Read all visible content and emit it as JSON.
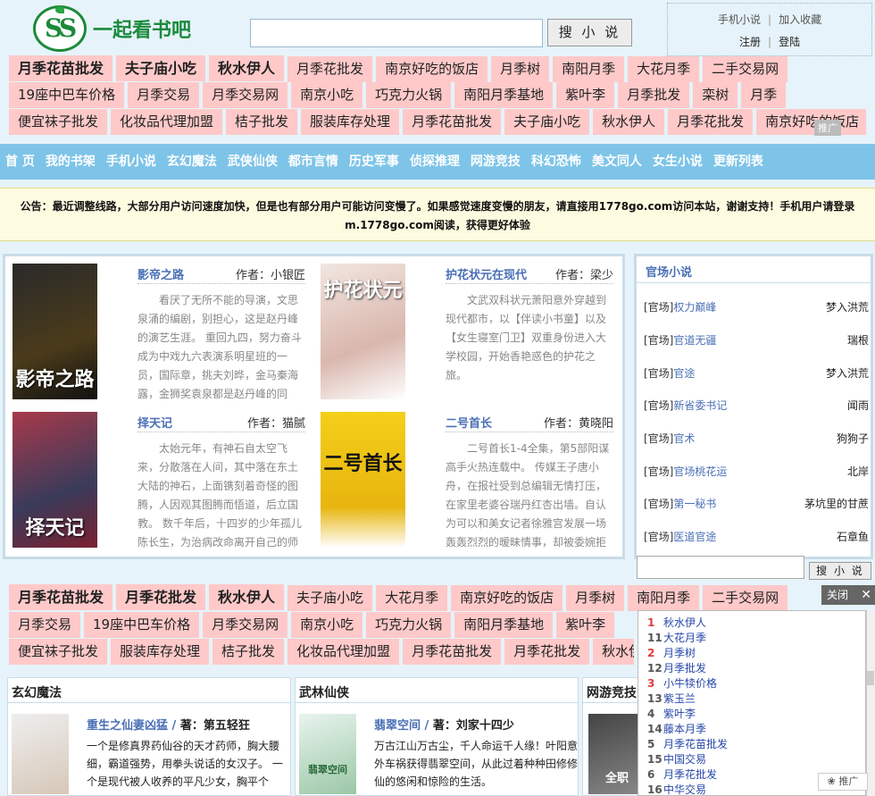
{
  "header": {
    "logo_text": "一起看书吧",
    "search_placeholder": "",
    "search_button": "搜 小 说",
    "user_links": [
      "手机小说",
      "加入收藏"
    ],
    "login_links": [
      "注册",
      "登陆"
    ]
  },
  "keywords_top": [
    [
      "月季花苗批发",
      "夫子庙小吃",
      "秋水伊人",
      "月季花批发",
      "南京好吃的饭店",
      "月季树",
      "南阳月季",
      "大花月季",
      "二手交易网"
    ],
    [
      "19座中巴车价格",
      "月季交易",
      "月季交易网",
      "南京小吃",
      "巧克力火锅",
      "南阳月季基地",
      "紫叶李",
      "月季批发",
      "栾树",
      "月季"
    ],
    [
      "便宜袜子批发",
      "化妆品代理加盟",
      "桔子批发",
      "服装库存处理",
      "月季花苗批发",
      "夫子庙小吃",
      "秋水伊人",
      "月季花批发",
      "南京好吃的饭店"
    ]
  ],
  "ad_tag": "推广",
  "nav": [
    "首 页",
    "我的书架",
    "手机小说",
    "玄幻魔法",
    "武侠仙侠",
    "都市言情",
    "历史军事",
    "侦探推理",
    "网游竞技",
    "科幻恐怖",
    "美文同人",
    "女生小说",
    "更新列表"
  ],
  "notice": "公告：最近调整线路，大部分用户访问速度加快，但是也有部分用户可能访问变慢了。如果感觉速度变慢的朋友，请直接用1778go.com访问本站，谢谢支持！手机用户请登录m.1778go.com阅读，获得更好体验",
  "featured": [
    {
      "title": "影帝之路",
      "author": "作者：小银匠",
      "cover_text": "影帝之路",
      "desc": "看厌了无所不能的导演，文思泉涌的编剧，别担心，这是赵丹峰的演艺生涯。 重回九四，努力奋斗成为中戏九六表演系明星班的一员，国际章，挑夫刘晔，金马秦海露，金狮奖袁泉都是赵丹峰的同"
    },
    {
      "title": "护花状元在现代",
      "author": "作者：梁少",
      "cover_text": "护花状元",
      "desc": "文武双科状元萧阳意外穿越到现代都市，以【伴读小书童】以及【女生寝室门卫】双重身份进入大学校园，开始香艳惑色的护花之旅。"
    },
    {
      "title": "择天记",
      "author": "作者：猫腻",
      "cover_text": "择天记",
      "desc": "太始元年，有神石自太空飞来，分散落在人间，其中落在东土大陆的神石，上面镌刻着奇怪的图腾，人因观其图腾而悟道，后立国教。 数千年后，十四岁的少年孤儿陈长生，为治病改命离开自己的师"
    },
    {
      "title": "二号首长",
      "author": "作者：黄晓阳",
      "cover_text": "二号首长",
      "desc": "二号首长1-4全集，第5部阳谋高手火热连载中。 传媒王子唐小舟，在报社受到总编辑无情打压，在家里老婆谷瑞丹红杏出墙。自认为可以和美女记者徐雅宫发展一场轰轰烈烈的暧昧情事，却被委婉拒"
    }
  ],
  "side": {
    "title": "官场小说",
    "items": [
      {
        "cat": "[官场]",
        "title": "权力巅峰",
        "author": "梦入洪荒"
      },
      {
        "cat": "[官场]",
        "title": "官道无疆",
        "author": "瑞根"
      },
      {
        "cat": "[官场]",
        "title": "官途",
        "author": "梦入洪荒"
      },
      {
        "cat": "[官场]",
        "title": "新省委书记",
        "author": "闻雨"
      },
      {
        "cat": "[官场]",
        "title": "官术",
        "author": "狗狗子"
      },
      {
        "cat": "[官场]",
        "title": "官场桃花运",
        "author": "北岸"
      },
      {
        "cat": "[官场]",
        "title": "第一秘书",
        "author": "茅坑里的甘蔗"
      },
      {
        "cat": "[官场]",
        "title": "医道官途",
        "author": "石章鱼"
      }
    ],
    "search_button": "搜 小 说"
  },
  "keywords_bottom": [
    [
      "月季花苗批发",
      "月季花批发",
      "秋水伊人",
      "夫子庙小吃",
      "大花月季",
      "南京好吃的饭店",
      "月季树",
      "南阳月季",
      "二手交易网"
    ],
    [
      "月季交易",
      "19座中巴车价格",
      "月季交易网",
      "南京小吃",
      "巧克力火锅",
      "南阳月季基地",
      "紫叶李"
    ],
    [
      "便宜袜子批发",
      "服装库存处理",
      "桔子批发",
      "化妆品代理加盟",
      "月季花苗批发",
      "月季花批发",
      "秋水伊人"
    ]
  ],
  "columns": [
    {
      "header": "玄幻魔法",
      "title": "重生之仙妻凶猛",
      "author": "著：第五轻狂",
      "cover_text": "仙妻",
      "desc": "一个是修真界药仙谷的天才药师，胸大腰细，霸道强势，用拳头说话的女汉子。 一个是现代被人收养的平凡少女，胸平个"
    },
    {
      "header": "武林仙侠",
      "title": "翡翠空间",
      "author": "著：刘家十四少",
      "cover_text": "翡翠空间",
      "desc": "万古江山万古尘，千人命运千人缘！叶阳意外车祸获得翡翠空间，从此过着种种田修修仙的悠闲和惊险的生活。"
    },
    {
      "header": "网游竞技",
      "title": "",
      "author": "",
      "cover_text": "全职",
      "desc": ""
    }
  ],
  "float_panel": {
    "close": "关闭",
    "items": [
      {
        "n": "1",
        "title": "秋水伊人"
      },
      {
        "n": "11",
        "title": "大花月季"
      },
      {
        "n": "2",
        "title": "月季树"
      },
      {
        "n": "12",
        "title": "月季批发"
      },
      {
        "n": "3",
        "title": "小牛犊价格"
      },
      {
        "n": "13",
        "title": "紫玉兰"
      },
      {
        "n": "4",
        "title": "紫叶李"
      },
      {
        "n": "14",
        "title": "藤本月季"
      },
      {
        "n": "5",
        "title": "月季花苗批发"
      },
      {
        "n": "15",
        "title": "中国交易"
      },
      {
        "n": "6",
        "title": "月季花批发"
      },
      {
        "n": "16",
        "title": "中华交易"
      }
    ],
    "ad": "推广"
  }
}
